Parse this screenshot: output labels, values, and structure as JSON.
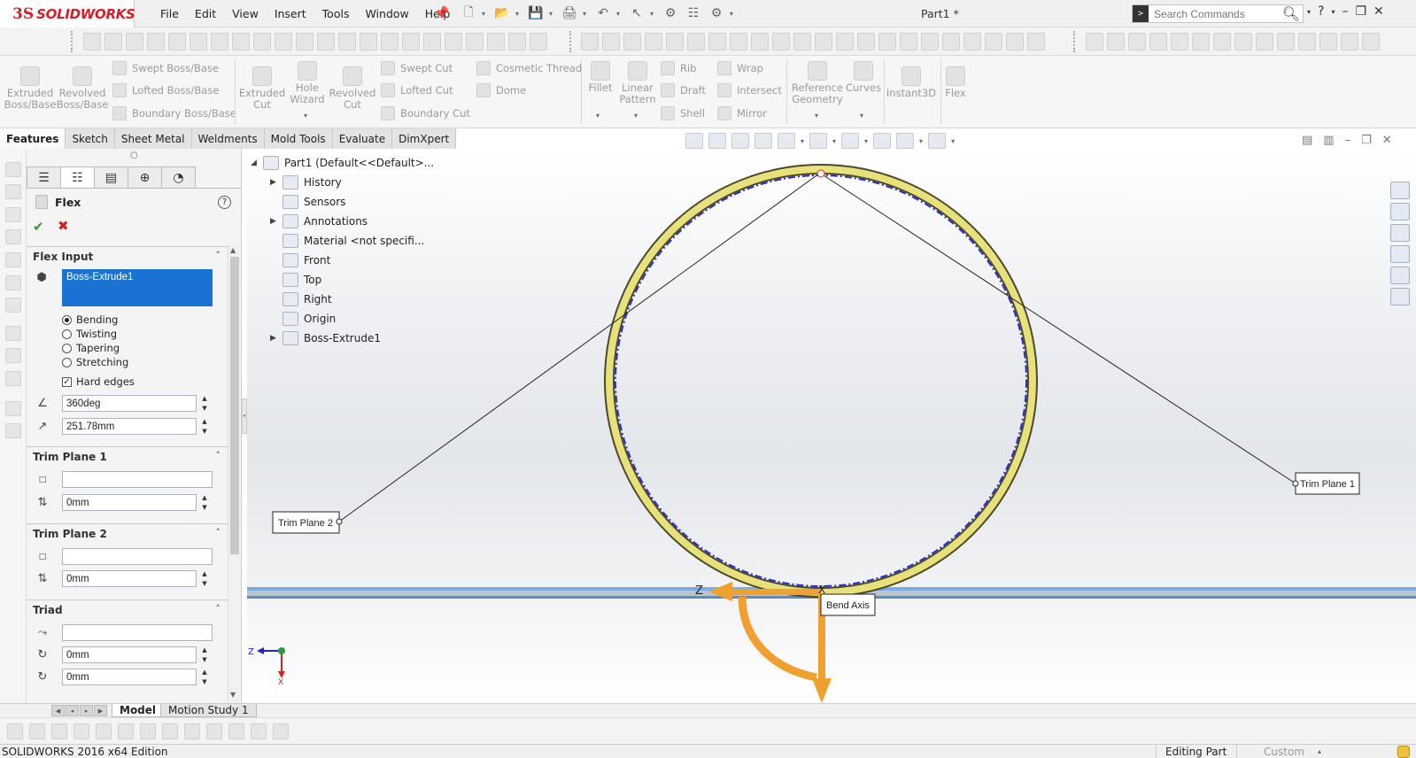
{
  "app": {
    "logo_mark": "3S",
    "logo_text": "SOLIDWORKS",
    "document_title": "Part1 *"
  },
  "menu": [
    "File",
    "Edit",
    "View",
    "Insert",
    "Tools",
    "Window",
    "Help"
  ],
  "search": {
    "placeholder": "Search Commands",
    "prompt_glyph": ">"
  },
  "help_glyph": "?",
  "ribbon": {
    "extruded_boss": "Extruded\nBoss/Base",
    "revolved_boss": "Revolved\nBoss/Base",
    "swept_boss": "Swept Boss/Base",
    "lofted_boss": "Lofted Boss/Base",
    "boundary_boss": "Boundary Boss/Base",
    "extruded_cut": "Extruded\nCut",
    "hole_wizard": "Hole\nWizard",
    "revolved_cut": "Revolved\nCut",
    "swept_cut": "Swept Cut",
    "lofted_cut": "Lofted Cut",
    "boundary_cut": "Boundary Cut",
    "cosmetic_thread": "Cosmetic Thread",
    "dome": "Dome",
    "fillet": "Fillet",
    "linear_pattern": "Linear\nPattern",
    "rib": "Rib",
    "draft": "Draft",
    "shell": "Shell",
    "wrap": "Wrap",
    "intersect": "Intersect",
    "mirror": "Mirror",
    "reference_geometry": "Reference\nGeometry",
    "curves": "Curves",
    "instant3d": "Instant3D",
    "flex": "Flex"
  },
  "tabs": [
    "Features",
    "Sketch",
    "Sheet Metal",
    "Weldments",
    "Mold Tools",
    "Evaluate",
    "DimXpert"
  ],
  "property_manager": {
    "title": "Flex",
    "flex_input": {
      "header": "Flex Input",
      "body": "Boss-Extrude1",
      "options": [
        "Bending",
        "Twisting",
        "Tapering",
        "Stretching"
      ],
      "selected": "Bending",
      "hard_edges_label": "Hard edges",
      "hard_edges_checked": true,
      "check_glyph": "✓",
      "angle": "360deg",
      "radius": "251.78mm"
    },
    "trim_plane_1": {
      "header": "Trim Plane 1",
      "selection": "",
      "offset": "0mm"
    },
    "trim_plane_2": {
      "header": "Trim Plane 2",
      "selection": "",
      "offset": "0mm"
    },
    "triad": {
      "header": "Triad",
      "selection": "",
      "x": "0mm",
      "y": "0mm"
    }
  },
  "feature_tree": {
    "root": "Part1  (Default<<Default>...",
    "items": [
      "History",
      "Sensors",
      "Annotations",
      "Material <not specifi...",
      "Front",
      "Top",
      "Right",
      "Origin",
      "Boss-Extrude1"
    ]
  },
  "callouts": {
    "trim_plane_1": "Trim Plane 1",
    "trim_plane_2": "Trim Plane 2",
    "bend_axis": "Bend Axis",
    "axis_z": "Z",
    "axis_x": "X"
  },
  "colors": {
    "logo_red": "#d32028",
    "selection_blue": "#1a73d3",
    "ring_yellow": "#e8e07a",
    "ring_dark": "#4a4a2a",
    "centerline_blue": "#2a2ad0",
    "triad_orange": "#f0a030"
  },
  "bottom_tabs": [
    "Model",
    "Motion Study 1"
  ],
  "status": {
    "edition": "SOLIDWORKS 2016 x64 Edition",
    "mode": "Editing Part",
    "units": "Custom"
  }
}
